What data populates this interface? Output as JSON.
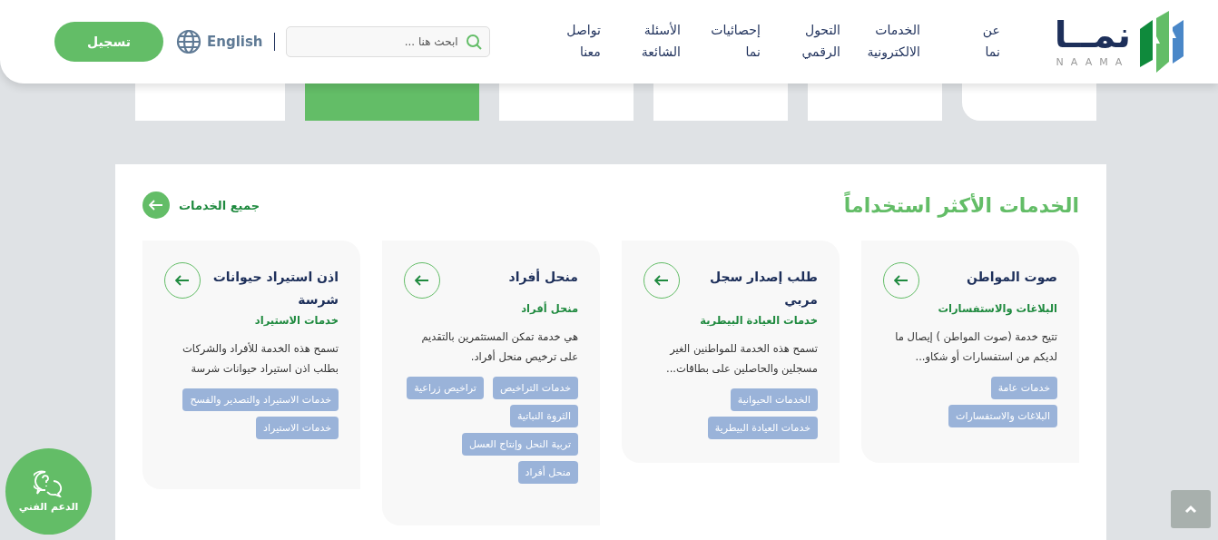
{
  "header": {
    "logo": {
      "text": "نمــا",
      "subtitle": "NAAMA"
    },
    "nav": [
      "عن\nنما",
      "الخدمات\nالالكترونية",
      "التحول\nالرقمي",
      "إحصائيات\nنما",
      "الأسئلة\nالشائعة",
      "تواصل\nمعنا"
    ],
    "search": {
      "placeholder": "ابحث هنا ..."
    },
    "language": "English",
    "login": "تسجيل"
  },
  "tabs": [
    {
      "selected": false
    },
    {
      "selected": false
    },
    {
      "selected": false
    },
    {
      "selected": false
    },
    {
      "selected": true
    },
    {
      "selected": false
    }
  ],
  "section": {
    "title": "الخدمات الأكثر استخداماً",
    "all_link": "جميع الخدمات"
  },
  "services": [
    {
      "title": "صوت المواطن",
      "category": "البلاغات والاستفسارات",
      "description": "تتيح خدمة (صوت المواطن ) إيصال ما لديكم من استفسارات أو شكاو...",
      "tags": [
        "خدمات عامة",
        "البلاغات والاستفسارات"
      ]
    },
    {
      "title": "طلب إصدار سجل مربي",
      "category": "خدمات العيادة البيطرية",
      "description": "تسمح هذه الخدمة للمواطنين الغير مسجلين والحاصلين على بطاقات...",
      "tags": [
        "الخدمات الحيوانية",
        "خدمات العيادة البيطرية"
      ]
    },
    {
      "title": "منحل أفراد",
      "category": "منحل أفراد",
      "description": "هي خدمة تمكن المستثمرين بالتقديم على ترخيص منحل أفراد.",
      "tags": [
        "خدمات التراخيص",
        "تراخيص زراعية",
        "الثروة النباتية",
        "تربية النحل وإنتاج العسل",
        "منحل أفراد"
      ]
    },
    {
      "title": "اذن استيراد حيوانات شرسة",
      "category": "خدمات الاستيراد",
      "description": "تسمح هذه الخدمة للأفراد والشركات بطلب اذن استيراد حيوانات شرسة",
      "tags": [
        "خدمات الاستيراد والتصدير والفسح",
        "خدمات الاستيراد"
      ]
    }
  ],
  "support": {
    "label": "الدعم الفني"
  }
}
